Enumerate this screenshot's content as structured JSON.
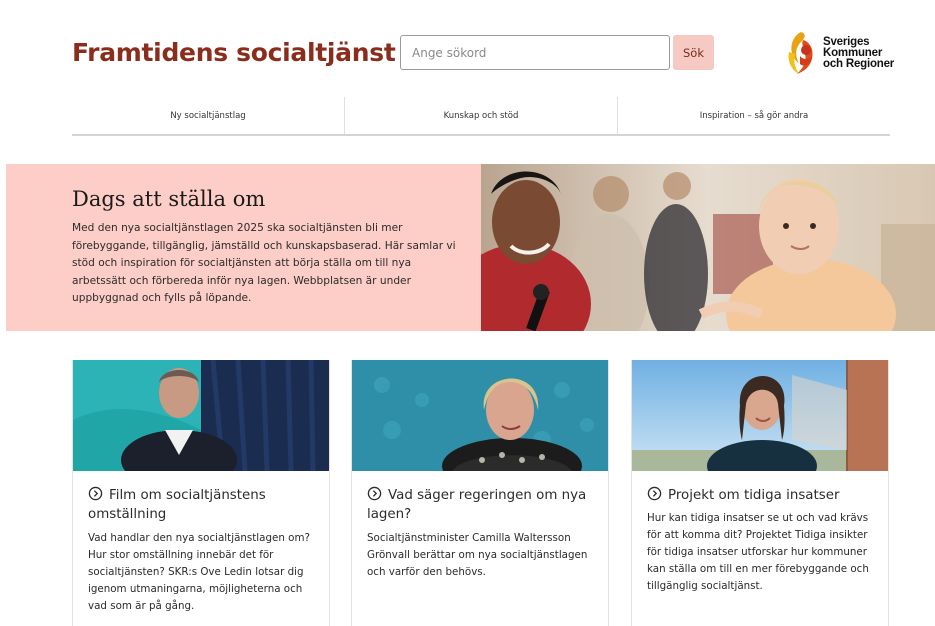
{
  "header": {
    "site_title": "Framtidens socialtjänst",
    "search_placeholder": "Ange sökord",
    "search_button": "Sök",
    "logo_lines": [
      "Sveriges",
      "Kommuner",
      "och Regioner"
    ]
  },
  "nav": {
    "items": [
      {
        "label": "Ny socialtjänstlag"
      },
      {
        "label": "Kunskap och stöd"
      },
      {
        "label": "Inspiration – så gör andra"
      }
    ]
  },
  "hero": {
    "title": "Dags att ställa om",
    "text": "Med den nya socialtjänstlagen 2025 ska socialtjänsten bli mer förebyggande, tillgänglig, jämställd och kunskapsbaserad. Här samlar vi stöd och inspiration för socialtjänsten att börja ställa om till nya arbetssätt och förbereda inför nya lagen. Webbplatsen är under uppbyggnad och fylls på löpande."
  },
  "cards": [
    {
      "title": "Film om socialtjänstens omställning",
      "description": "Vad handlar den nya socialtjänstlagen om? Hur stor omställning innebär det för socialtjänsten? SKR:s Ove Ledin lotsar dig igenom utmaningarna, möjligheterna och vad som är på gång."
    },
    {
      "title": "Vad säger regeringen om nya lagen?",
      "description": "Socialtjänstminister Camilla Waltersson Grönvall berättar om nya socialtjänstlagen och varför den behövs."
    },
    {
      "title": "Projekt om tidiga insatser",
      "description": "Hur kan tidiga insatser se ut och vad krävs för att komma dit? Projektet Tidiga insikter för tidiga insatser utforskar hur kommuner kan ställa om till en mer förebyggande och tillgänglig socialtjänst."
    }
  ],
  "colors": {
    "brand": "#8b2d1c",
    "hero_bg": "#fdcdc7",
    "button_bg": "#f7c9c3"
  }
}
